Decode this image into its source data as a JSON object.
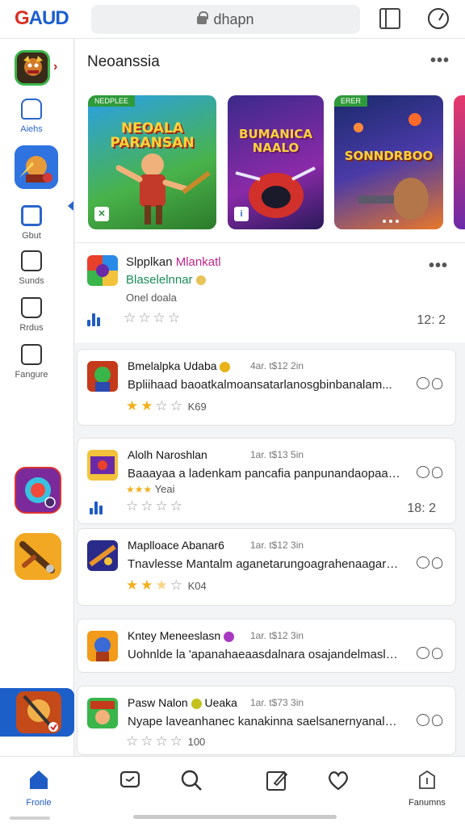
{
  "browser": {
    "logo": "GAUD",
    "url": "dhapn"
  },
  "sidebar": {
    "items": [
      {
        "label": "Aiehs"
      },
      {
        "label": "Gbut"
      },
      {
        "label": "Sunds"
      },
      {
        "label": "Rrdus"
      },
      {
        "label": "Fangure"
      }
    ]
  },
  "main": {
    "section_title": "Neoanssia",
    "more": "•••",
    "banners": [
      {
        "title": "NEOALA\nPARANSAN",
        "tag": "NEDPLEE"
      },
      {
        "title": "BUMANICA\nNAALO",
        "tag": ""
      },
      {
        "title": "SONNDRBOO",
        "tag": "ERER"
      }
    ],
    "featured": {
      "title_a": "Slpplkan",
      "title_b": "Mlankatl",
      "subtitle": "Blaselelnnar",
      "tag": "Onel doala",
      "rating": 0,
      "count": "12: 2"
    },
    "posts": [
      {
        "name": "Bmelalpka Udaba",
        "time": "4ar. t$12 2in",
        "desc": "Bpliihaad baoatkalmoansatarlanosgbinbanalam...",
        "rating": 2,
        "extra": "K69"
      },
      {
        "name": "Alolh Naroshlan",
        "time": "1ar. t$13 5in",
        "desc": "Baaayaa a ladenkam pancafia panpunandaopaasra",
        "rating": 0,
        "tag": "Yeai",
        "count": "18: 2"
      },
      {
        "name": "Maplloace Abanar6",
        "time": "1ar. t$12 3in",
        "desc": "Tnavlesse Mantalm aganetarungoagrahenaagarak...",
        "rating": 2.5,
        "extra": "K04"
      },
      {
        "name": "Kntey Meneeslasn",
        "time": "1ar. t$12 3in",
        "desc": "Uohnlde la 'apanahaeaasdalnara osajandelmasler...",
        "rating": 0
      },
      {
        "name": "Pasw Nalon",
        "name_b": "Ueaka",
        "time": "1ar. t$73 3in",
        "desc": "Nyape laveanhanec kanakinna saelsanernyanalm...",
        "rating": 0,
        "extra": "100"
      }
    ]
  },
  "bottom_nav": {
    "items": [
      {
        "label": "Fronle"
      },
      {
        "label": ""
      },
      {
        "label": ""
      },
      {
        "label": ""
      },
      {
        "label": ""
      },
      {
        "label": "Fanumns"
      }
    ]
  }
}
